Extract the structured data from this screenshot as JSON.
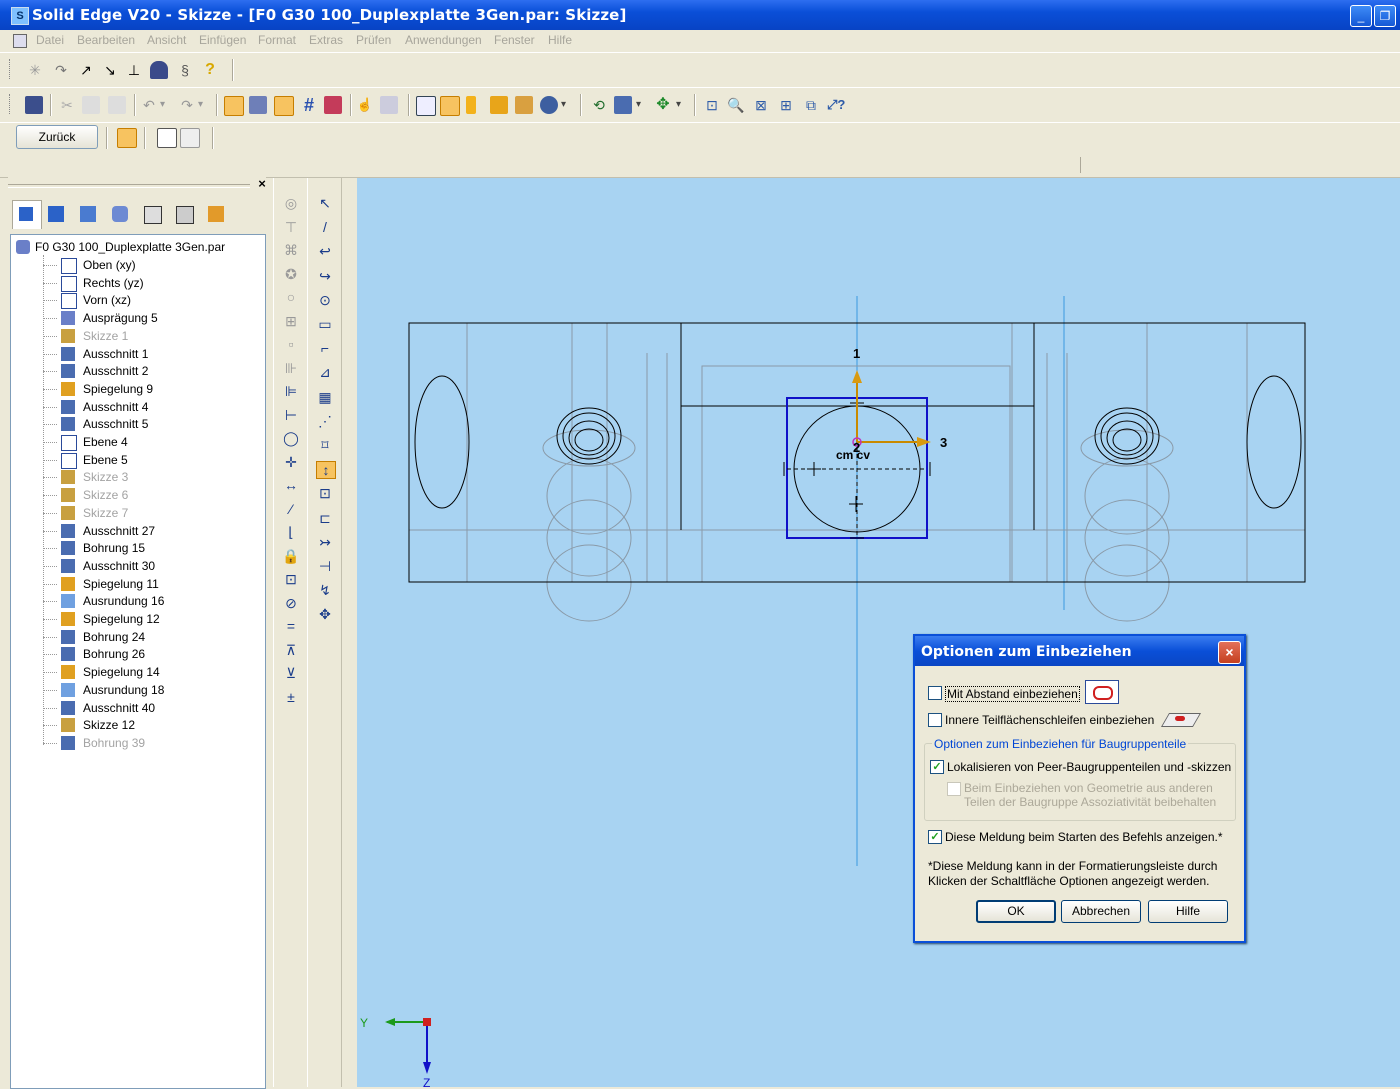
{
  "window": {
    "title": "Solid Edge V20 - Skizze - [F0 G30 100_Duplexplatte 3Gen.par: Skizze]",
    "min_label": "_",
    "restore_label": "❐"
  },
  "menu": [
    "Datei",
    "Bearbeiten",
    "Ansicht",
    "Einfügen",
    "Format",
    "Extras",
    "Prüfen",
    "Anwendungen",
    "Fenster",
    "Hilfe"
  ],
  "ribbon": {
    "back_label": "Zurück"
  },
  "tree": {
    "close_label": "×",
    "root": "F0 G30 100_Duplexplatte 3Gen.par",
    "items": [
      {
        "label": "Oben (xy)",
        "icon": "plane-icon",
        "state": "normal"
      },
      {
        "label": "Rechts (yz)",
        "icon": "plane-icon",
        "state": "normal"
      },
      {
        "label": "Vorn (xz)",
        "icon": "plane-icon",
        "state": "normal"
      },
      {
        "label": "Ausprägung 5",
        "icon": "protrusion-icon",
        "state": "normal"
      },
      {
        "label": "Skizze 1",
        "icon": "sketch-icon",
        "state": "gray"
      },
      {
        "label": "Ausschnitt 1",
        "icon": "cutout-icon",
        "state": "normal"
      },
      {
        "label": "Ausschnitt 2",
        "icon": "cutout-icon",
        "state": "normal"
      },
      {
        "label": "Spiegelung 9",
        "icon": "mirror-icon",
        "state": "normal"
      },
      {
        "label": "Ausschnitt 4",
        "icon": "cutout-icon",
        "state": "normal"
      },
      {
        "label": "Ausschnitt 5",
        "icon": "cutout-icon",
        "state": "normal"
      },
      {
        "label": "Ebene 4",
        "icon": "plane-icon",
        "state": "normal"
      },
      {
        "label": "Ebene 5",
        "icon": "plane-icon",
        "state": "normal"
      },
      {
        "label": "Skizze 3",
        "icon": "sketch-icon",
        "state": "gray"
      },
      {
        "label": "Skizze 6",
        "icon": "sketch-icon",
        "state": "gray"
      },
      {
        "label": "Skizze 7",
        "icon": "sketch-icon",
        "state": "gray"
      },
      {
        "label": "Ausschnitt 27",
        "icon": "cutout-icon",
        "state": "normal"
      },
      {
        "label": "Bohrung 15",
        "icon": "hole-icon",
        "state": "normal"
      },
      {
        "label": "Ausschnitt 30",
        "icon": "cutout-icon",
        "state": "normal"
      },
      {
        "label": "Spiegelung 11",
        "icon": "mirror-icon",
        "state": "normal"
      },
      {
        "label": "Ausrundung 16",
        "icon": "round-icon",
        "state": "normal"
      },
      {
        "label": "Spiegelung 12",
        "icon": "mirror-icon",
        "state": "normal"
      },
      {
        "label": "Bohrung 24",
        "icon": "hole-icon",
        "state": "normal"
      },
      {
        "label": "Bohrung 26",
        "icon": "hole-icon",
        "state": "normal"
      },
      {
        "label": "Spiegelung 14",
        "icon": "mirror-icon",
        "state": "normal"
      },
      {
        "label": "Ausrundung 18",
        "icon": "round-icon",
        "state": "normal"
      },
      {
        "label": "Ausschnitt 40",
        "icon": "cutout-icon",
        "state": "normal"
      },
      {
        "label": "Skizze 12",
        "icon": "sketch-icon",
        "state": "normal"
      },
      {
        "label": "Bohrung 39",
        "icon": "hole-icon",
        "state": "gray"
      }
    ]
  },
  "canvas": {
    "axis_1": "1",
    "axis_2": "2",
    "axis_3": "3",
    "center_label": "cm cv",
    "triad_y": "Y",
    "triad_z": "Z"
  },
  "dialog": {
    "title": "Optionen zum Einbeziehen",
    "close": "×",
    "opt_offset": "Mit Abstand einbeziehen",
    "opt_offset_checked": false,
    "opt_inner": "Innere Teilflächenschleifen einbeziehen",
    "opt_inner_checked": false,
    "group_label": "Optionen zum Einbeziehen für Baugruppenteile",
    "opt_locate": "Lokalisieren von Peer-Baugruppenteilen und -skizzen",
    "opt_locate_checked": true,
    "opt_assoc_line1": "Beim Einbeziehen von Geometrie aus anderen",
    "opt_assoc_line2": "Teilen der Baugruppe Assoziativität beibehalten",
    "opt_assoc_checked": false,
    "opt_show": "Diese Meldung beim Starten des Befehls anzeigen.*",
    "opt_show_checked": true,
    "note_line1": "*Diese Meldung kann in der Formatierungsleiste durch",
    "note_line2": "Klicken der Schaltfläche Optionen angezeigt werden.",
    "ok": "OK",
    "cancel": "Abbrechen",
    "help": "Hilfe"
  }
}
